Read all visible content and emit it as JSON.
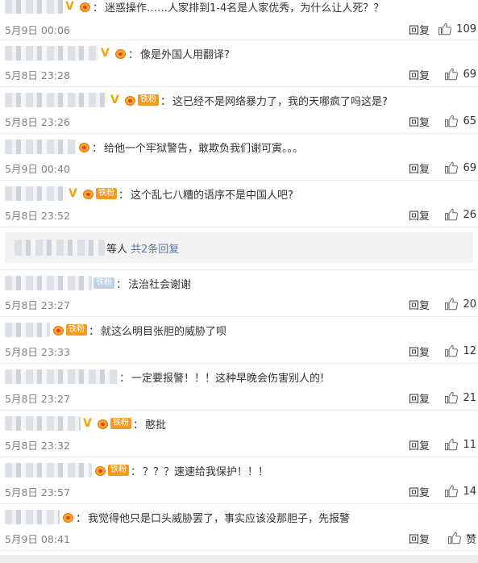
{
  "comments": [
    {
      "badge_v": true,
      "medal": true,
      "fan": "",
      "text": "迷惑操作……人家排到1-4名是人家优秀，为什么让人死？？",
      "time": "5月9日 00:06",
      "reply": "回复",
      "likes": "109"
    },
    {
      "badge_v": true,
      "medal": true,
      "fan": "",
      "text": "像是外国人用翻译?",
      "time": "5月8日 23:28",
      "reply": "回复",
      "likes": "69"
    },
    {
      "badge_v": true,
      "medal": true,
      "fan": "铁粉",
      "text": "这已经不是网络暴力了，我的天哪疯了吗这是?",
      "time": "5月8日 23:26",
      "reply": "回复",
      "likes": "65"
    },
    {
      "badge_v": false,
      "medal": true,
      "fan": "",
      "text": "给他一个牢狱警告，敢欺负我们谢可寅。。。",
      "time": "5月9日 00:40",
      "reply": "回复",
      "likes": "69"
    },
    {
      "badge_v": true,
      "medal": true,
      "fan": "铁粉",
      "text": "这个乱七八糟的语序不是中国人吧?",
      "time": "5月8日 23:52",
      "reply": "回复",
      "likes": "26"
    }
  ],
  "more_replies": {
    "who": "等人",
    "count": "共2条回复"
  },
  "comments2": [
    {
      "badge_v": false,
      "medal": false,
      "fan": "铁粉",
      "text": "法治社会谢谢",
      "time": "5月8日 23:27",
      "reply": "回复",
      "likes": "20"
    },
    {
      "badge_v": false,
      "medal": true,
      "fan": "铁粉",
      "text": "就这么明目张胆的威胁了呗",
      "time": "5月8日 23:33",
      "reply": "回复",
      "likes": "12"
    },
    {
      "badge_v": false,
      "medal": false,
      "fan": "",
      "text": "一定要报警！！！这种早晚会伤害别人的!",
      "time": "5月8日 23:27",
      "reply": "回复",
      "likes": "21"
    },
    {
      "badge_v": true,
      "medal": true,
      "fan": "铁粉",
      "text": "憨批",
      "time": "5月8日 23:32",
      "reply": "回复",
      "likes": "11"
    },
    {
      "badge_v": false,
      "medal": true,
      "fan": "铁粉",
      "text": "？？？速速给我保护！！！",
      "time": "5月8日 23:57",
      "reply": "回复",
      "likes": "14"
    },
    {
      "badge_v": false,
      "medal": true,
      "fan": "",
      "text": "我觉得他只是口头威胁罢了，事实应该没那胆子，先报警",
      "time": "5月9日 08:41",
      "reply": "回复",
      "likes": "赞"
    }
  ],
  "colors": {
    "link": "#5b7aa8",
    "fan_badge": "#f29b1f",
    "v_badge": "#f2a400",
    "time": "#808080"
  },
  "icons": {
    "like": "thumbs-up-icon",
    "v": "verified-v-icon",
    "medal": "fan-medal-icon"
  }
}
